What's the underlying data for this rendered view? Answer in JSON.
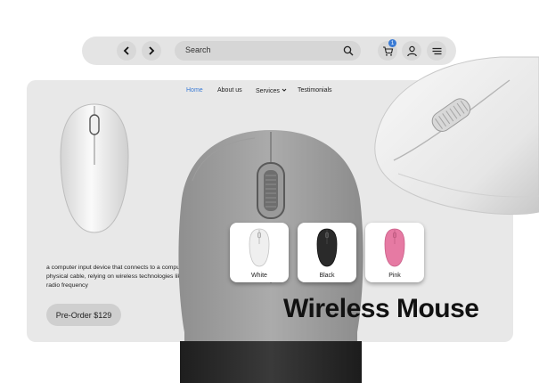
{
  "browser": {
    "search_placeholder": "Search",
    "cart_count": "1",
    "icons": [
      "chevron-left-icon",
      "chevron-right-icon",
      "search-icon",
      "cart-icon",
      "user-icon",
      "menu-icon"
    ]
  },
  "nav": {
    "items": [
      {
        "label": "Home",
        "active": true
      },
      {
        "label": "About us",
        "active": false
      },
      {
        "label": "Services",
        "active": false
      },
      {
        "label": "Testimonials",
        "active": false
      }
    ]
  },
  "hero": {
    "description": "a computer input device that connects to a computer without a physical cable, relying on wireless technologies like Bluetooth or radio frequency",
    "cta_label": "Pre-Order $129",
    "title": "Wireless Mouse"
  },
  "colors": [
    {
      "label": "White",
      "hex": "#eeeeee"
    },
    {
      "label": "Black",
      "hex": "#2a2a2a"
    },
    {
      "label": "Pink",
      "hex": "#e67aa3"
    }
  ],
  "theme": {
    "accent": "#3a7bd5",
    "card_bg": "#e8e8e8"
  }
}
